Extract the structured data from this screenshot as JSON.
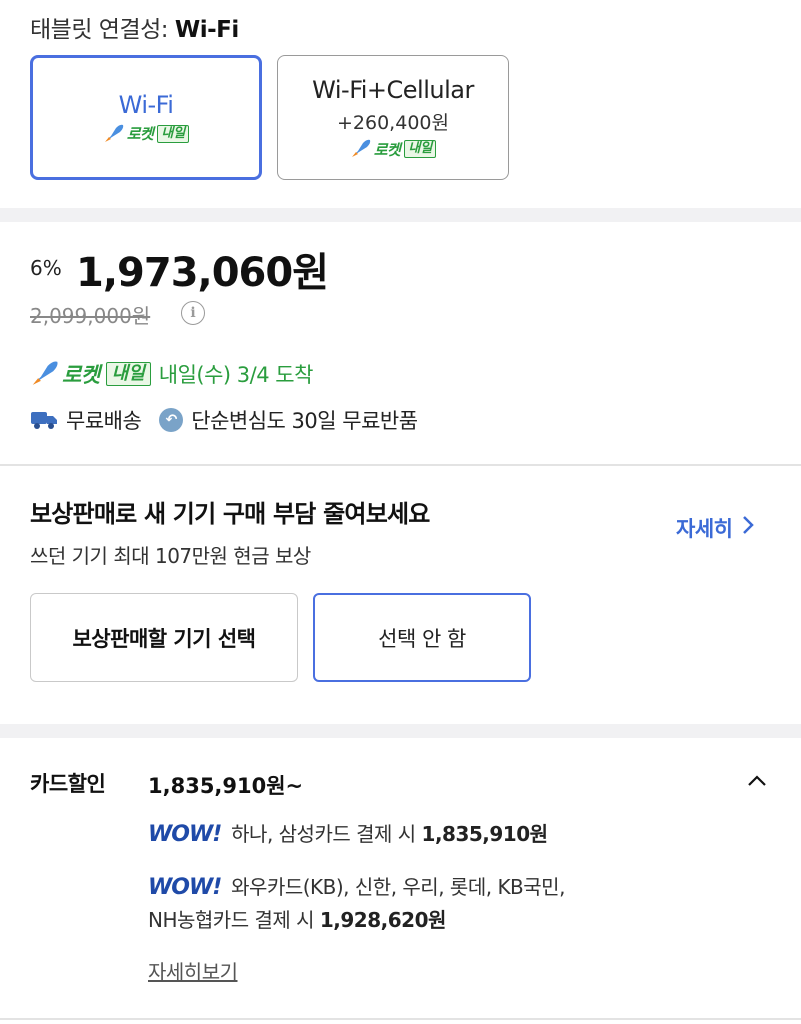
{
  "connectivity": {
    "label": "태블릿 연결성:",
    "value": "Wi-Fi",
    "options": [
      {
        "name": "Wi-Fi",
        "price": "",
        "rocket": "로켓",
        "badge": "내일",
        "selected": true
      },
      {
        "name": "Wi-Fi+Cellular",
        "price": "+260,400원",
        "rocket": "로켓",
        "badge": "내일",
        "selected": false
      }
    ]
  },
  "pricing": {
    "discount": "6%",
    "price": "1,973,060원",
    "original_price": "2,099,000원",
    "info_icon_text": "i"
  },
  "delivery": {
    "rocket": "로켓",
    "badge": "내일",
    "arrival": "내일(수) 3/4 도착",
    "free_shipping": "무료배송",
    "free_return": "단순변심도 30일 무료반품"
  },
  "trade_in": {
    "title": "보상판매로 새 기기 구매 부담 줄여보세요",
    "subtitle": "쓰던 기기 최대 107만원 현금 보상",
    "more_link": "자세히",
    "select_button": "보상판매할 기기 선택",
    "skip_button": "선택 안 함"
  },
  "card_discount": {
    "label": "카드할인",
    "value": "1,835,910원~",
    "offers": [
      {
        "brand": "WOW!",
        "text": "하나, 삼성카드 결제 시 ",
        "amount": "1,835,910원"
      },
      {
        "brand": "WOW!",
        "text_line1": "와우카드(KB), 신한, 우리, 롯데, KB국민,",
        "text_line2": "NH농협카드 결제 시 ",
        "amount": "1,928,620원"
      }
    ],
    "detail_link": "자세히보기"
  },
  "colors": {
    "accent_blue": "#3b6ad6",
    "rocket_green": "#2a9d3e",
    "wow_blue": "#1f4aa8"
  },
  "icons": [
    "rocket-icon",
    "info-icon",
    "truck-icon",
    "return-icon",
    "chevron-right-icon",
    "chevron-up-icon"
  ]
}
